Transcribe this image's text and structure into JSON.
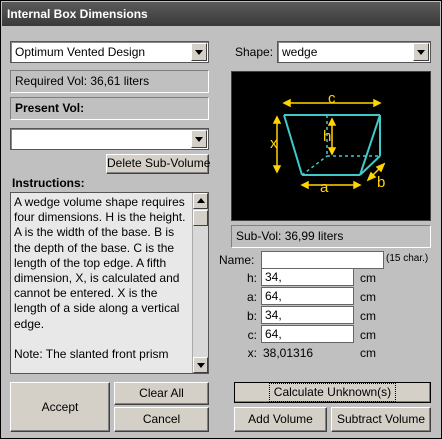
{
  "window": {
    "title": "Internal Box Dimensions"
  },
  "left": {
    "design_select": "Optimum Vented Design",
    "required_vol": "Required Vol: 36,61 liters",
    "present_vol_label": "Present Vol:",
    "subvolume_select": "",
    "delete_button": "Delete Sub-Volume",
    "instructions_label": "Instructions:",
    "instructions_text": "A wedge volume shape requires four dimensions. H is the height. A is the width of the base. B is the depth of the base. C is the length of the top edge. A fifth dimension, X, is calculated and cannot be entered. X is the length of a side along a vertical edge.\n\nNote: The slanted front prism"
  },
  "right": {
    "shape_label": "Shape:",
    "shape_select": "wedge",
    "diagram_labels": {
      "c": "c",
      "h": "h",
      "x": "x",
      "a": "a",
      "b": "b"
    },
    "sub_vol": "Sub-Vol: 36,99 liters",
    "name_label": "Name:",
    "name_hint": "(15 char.)",
    "name_value": "",
    "fields": [
      {
        "label": "h:",
        "value": "34,",
        "unit": "cm"
      },
      {
        "label": "a:",
        "value": "64,",
        "unit": "cm"
      },
      {
        "label": "b:",
        "value": "34,",
        "unit": "cm"
      },
      {
        "label": "c:",
        "value": "64,",
        "unit": "cm"
      }
    ],
    "x_row": {
      "label": "x:",
      "value": "38,01316",
      "unit": "cm"
    }
  },
  "buttons": {
    "accept": "Accept",
    "clear_all": "Clear All",
    "cancel": "Cancel",
    "calculate": "Calculate Unknown(s)",
    "add_volume": "Add Volume",
    "subtract_volume": "Subtract Volume"
  },
  "colors": {
    "diagram_line": "#3fc9c9",
    "diagram_dim": "#ffd400"
  }
}
